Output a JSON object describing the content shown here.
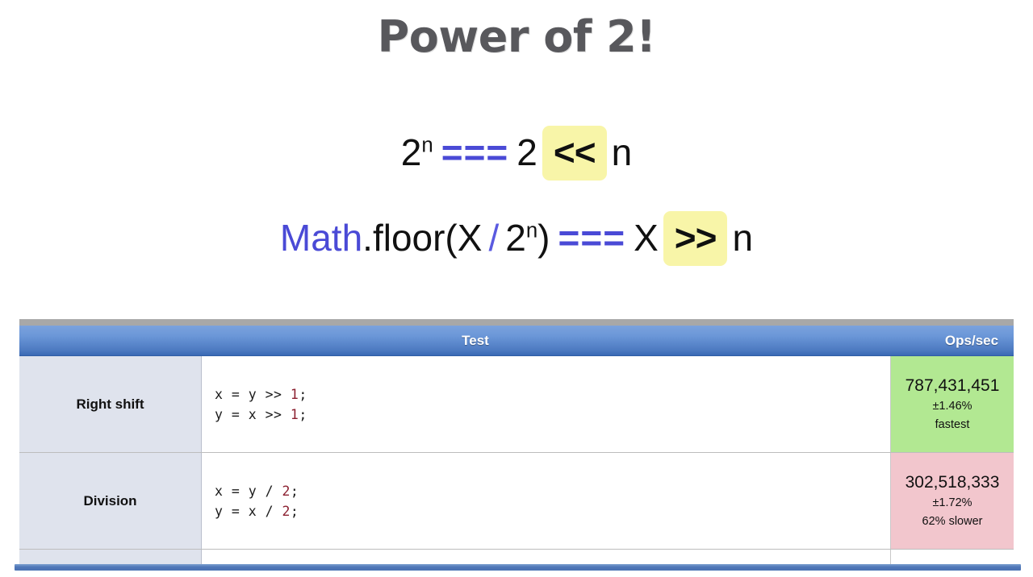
{
  "slide": {
    "title": "Power of 2!"
  },
  "formulas": {
    "line1": {
      "base": "2",
      "exponent": "n",
      "equals": "===",
      "two": "2",
      "operator": "<<",
      "n": "n",
      "highlight_color": "#f8f5a8",
      "equals_color": "#4a4ad6"
    },
    "line2": {
      "math": "Math",
      "floor_open": ".floor(X",
      "slash": "/",
      "base": "2",
      "exponent": "n",
      "close": ")",
      "equals": "===",
      "x": "X",
      "operator": ">>",
      "n": "n"
    }
  },
  "table": {
    "headers": {
      "test": "Test",
      "ops": "Ops/sec"
    },
    "rows": [
      {
        "name": "Right shift",
        "code_line1_pre": "x = y >> ",
        "code_line1_num": "1",
        "code_line1_post": ";",
        "code_line2_pre": "y = x >> ",
        "code_line2_num": "1",
        "code_line2_post": ";",
        "ops": "787,431,451",
        "margin": "±1.46%",
        "note": "fastest",
        "ops_color": "#b2e892"
      },
      {
        "name": "Division",
        "code_line1_pre": "x = y / ",
        "code_line1_num": "2",
        "code_line1_post": ";",
        "code_line2_pre": "y = x / ",
        "code_line2_num": "2",
        "code_line2_post": ";",
        "ops": "302,518,333",
        "margin": "±1.72%",
        "note": "62% slower",
        "ops_color": "#f2c6cd"
      }
    ]
  }
}
